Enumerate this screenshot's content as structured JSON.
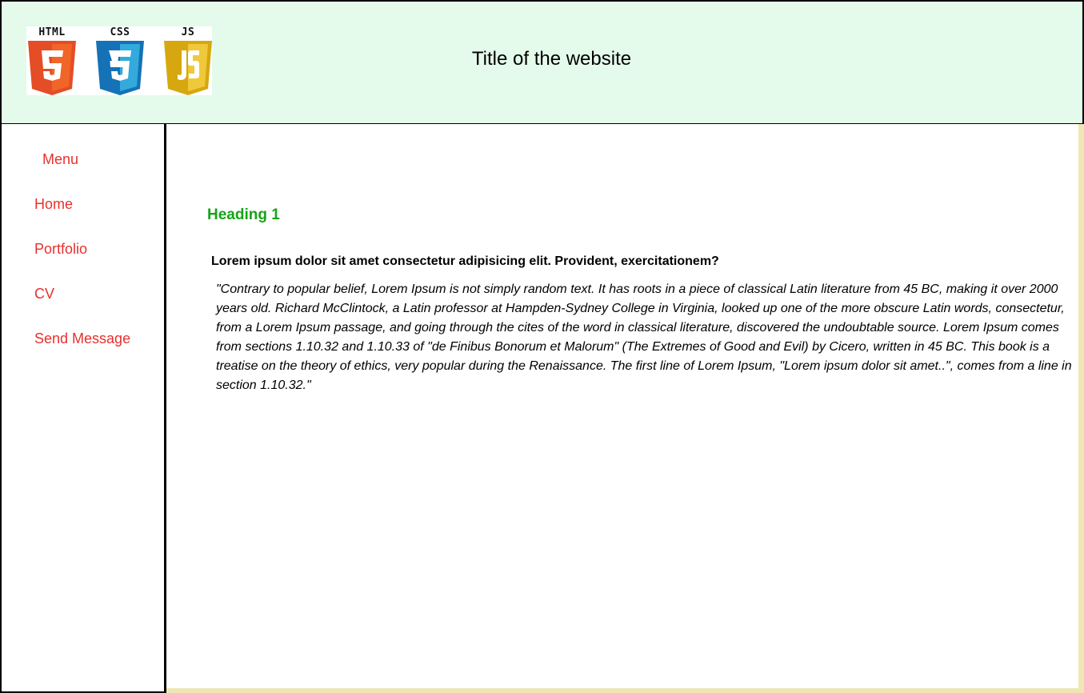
{
  "header": {
    "logos": [
      {
        "label": "HTML",
        "digit": "5",
        "icon": "html5-logo-icon",
        "color": "#e44d26",
        "shade": "#f16529"
      },
      {
        "label": "CSS",
        "digit": "3",
        "icon": "css3-logo-icon",
        "color": "#1572b6",
        "shade": "#33a9dc"
      },
      {
        "label": "JS",
        "digit": "JS",
        "icon": "javascript-logo-icon",
        "color": "#d6a70f",
        "shade": "#f0c93a"
      }
    ],
    "title": "Title of the website"
  },
  "sidebar": {
    "menu_title": "Menu",
    "items": [
      {
        "label": "Home"
      },
      {
        "label": "Portfolio"
      },
      {
        "label": "CV"
      },
      {
        "label": "Send Message"
      }
    ]
  },
  "main": {
    "heading": "Heading 1",
    "subheading": "Lorem ipsum dolor sit amet consectetur adipisicing elit. Provident, exercitationem?",
    "quote": "\"Contrary to popular belief, Lorem Ipsum is not simply random text. It has roots in a piece of classical Latin literature from 45 BC, making it over 2000 years old. Richard McClintock, a Latin professor at Hampden-Sydney College in Virginia, looked up one of the more obscure Latin words, consectetur, from a Lorem Ipsum passage, and going through the cites of the word in classical literature, discovered the undoubtable source. Lorem Ipsum comes from sections 1.10.32 and 1.10.33 of \"de Finibus Bonorum et Malorum\" (The Extremes of Good and Evil) by Cicero, written in 45 BC. This book is a treatise on the theory of ethics, very popular during the Renaissance. The first line of Lorem Ipsum, \"Lorem ipsum dolor sit amet..\", comes from a line in section 1.10.32.\""
  },
  "colors": {
    "header_bg": "#e4faea",
    "nav_text": "#e8302d",
    "heading": "#17a317",
    "main_border": "#efe6b4"
  }
}
